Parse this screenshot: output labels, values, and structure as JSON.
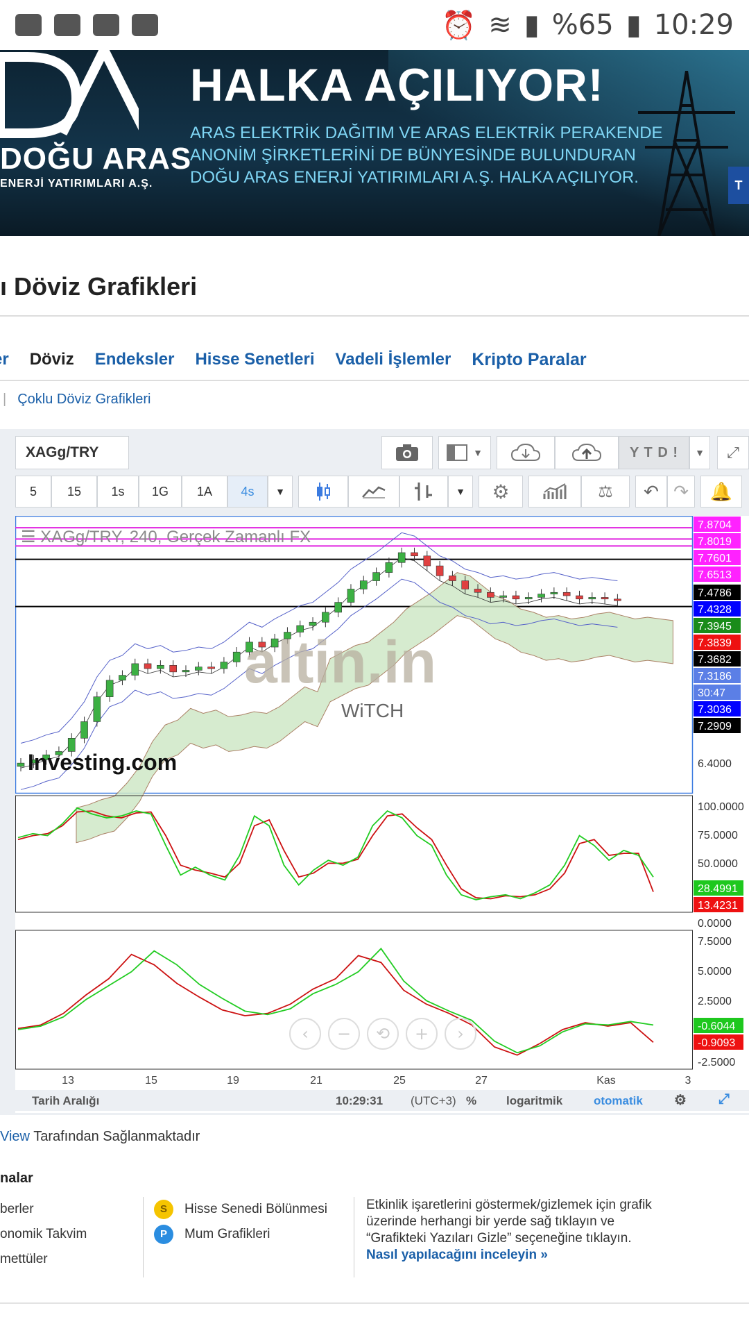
{
  "status_bar": {
    "battery": "%65",
    "time": "10:29"
  },
  "banner": {
    "logo_name": "DOĞU ARAS",
    "logo_sub": "ENERJİ YATIRIMLARI A.Ş.",
    "headline": "HALKA AÇILIYOR!",
    "subtext": "ARAS ELEKTRİK DAĞITIM VE ARAS ELEKTRİK PERAKENDE ANONİM ŞİRKETLERİNİ DE BÜNYESİNDE BULUNDURAN DOĞU ARAS ENERJİ YATIRIMLARI A.Ş. HALKA AÇILIYOR.",
    "side_tab": "T"
  },
  "page_title": "ı Döviz Grafikleri",
  "nav": {
    "items": [
      "er",
      "Döviz",
      "Endeksler",
      "Hisse Senetleri",
      "Vadeli İşlemler",
      "Kripto Paralar"
    ],
    "active": "Döviz"
  },
  "subnav": {
    "link": "Çoklu Döviz Grafikleri"
  },
  "toolbar": {
    "symbol": "XAGg/TRY",
    "ytd": "Y T D !",
    "timeframes": [
      "5",
      "15",
      "1s",
      "1G",
      "1A",
      "4s"
    ],
    "selected_timeframe": "4s"
  },
  "chart_header": "XAGg/TRY, 240, Gerçek Zamanlı FX",
  "watermark": {
    "brand": "altin.in",
    "sub": "WiTCH",
    "investing": "Investing.com"
  },
  "chart_data": {
    "type": "candlestick",
    "price_axis_labels": [
      "7.8704",
      "7.8019",
      "7.7601",
      "7.6513",
      "7.4786",
      "7.4328",
      "7.3945",
      "7.3839",
      "7.3682",
      "7.3186",
      "30:47",
      "7.3036",
      "7.2909",
      "6.4000"
    ],
    "price_label_colors": [
      "#ff22ff",
      "#ff22ff",
      "#ff22ff",
      "#ff22ff",
      "#000000",
      "#0000ff",
      "#1a8c1a",
      "#ee1111",
      "#000000",
      "#5b7fe6",
      "#5b7fe6",
      "#0000ff",
      "#000000",
      "#ffffff"
    ],
    "x_ticks": [
      "13",
      "15",
      "19",
      "21",
      "25",
      "27",
      "Kas",
      "3"
    ],
    "closes": [
      6.45,
      6.47,
      6.5,
      6.52,
      6.6,
      6.7,
      6.85,
      6.95,
      6.98,
      7.05,
      7.02,
      7.04,
      7.0,
      7.01,
      7.03,
      7.02,
      7.06,
      7.12,
      7.18,
      7.15,
      7.2,
      7.24,
      7.28,
      7.3,
      7.36,
      7.42,
      7.5,
      7.55,
      7.6,
      7.66,
      7.72,
      7.7,
      7.64,
      7.58,
      7.55,
      7.5,
      7.48,
      7.45,
      7.46,
      7.44,
      7.45,
      7.47,
      7.48,
      7.46,
      7.44,
      7.45,
      7.44,
      7.43
    ],
    "stochastic": {
      "labels": [
        "100.0000",
        "75.0000",
        "50.0000",
        "28.4991",
        "13.4231",
        "0.0000"
      ],
      "k_color": "#22cc22",
      "d_color": "#cc1111",
      "k": [
        68,
        72,
        70,
        82,
        98,
        92,
        88,
        90,
        95,
        92,
        60,
        30,
        38,
        30,
        25,
        50,
        90,
        80,
        40,
        20,
        35,
        45,
        40,
        48,
        80,
        95,
        88,
        70,
        60,
        30,
        10,
        5,
        8,
        10,
        6,
        12,
        20,
        40,
        70,
        60,
        45,
        55,
        50,
        28
      ],
      "d": [
        66,
        70,
        72,
        80,
        94,
        95,
        90,
        88,
        93,
        94,
        70,
        40,
        35,
        32,
        28,
        42,
        80,
        86,
        55,
        28,
        32,
        42,
        42,
        46,
        70,
        90,
        92,
        78,
        66,
        40,
        16,
        7,
        6,
        9,
        8,
        10,
        16,
        32,
        62,
        66,
        50,
        52,
        52,
        13
      ]
    },
    "indicator2": {
      "labels": [
        "7.5000",
        "5.0000",
        "2.5000",
        "-0.6044",
        "-0.9093",
        "-2.5000"
      ],
      "green": [
        0.2,
        0.5,
        1.3,
        2.8,
        4.0,
        5.2,
        7.0,
        5.8,
        4.1,
        2.9,
        1.8,
        1.5,
        2.0,
        3.3,
        4.1,
        5.2,
        7.2,
        4.4,
        2.7,
        1.8,
        1.0,
        -0.8,
        -1.8,
        -1.2,
        0.0,
        0.7,
        0.6,
        0.9,
        0.6
      ],
      "red": [
        0.3,
        0.6,
        1.6,
        3.2,
        4.6,
        6.7,
        5.8,
        4.2,
        3.0,
        1.9,
        1.4,
        1.6,
        2.4,
        3.7,
        4.6,
        6.6,
        6.0,
        3.6,
        2.4,
        1.6,
        0.6,
        -1.3,
        -2.0,
        -1.0,
        0.2,
        0.8,
        0.5,
        0.8,
        -0.9
      ]
    }
  },
  "zoom_controls": [
    "‹",
    "−",
    "⟲",
    "+",
    "›"
  ],
  "bottom_bar": {
    "range": "Tarih Aralığı",
    "time": "10:29:31",
    "tz": "(UTC+3)",
    "percent": "%",
    "log": "logaritmik",
    "auto": "otomatik"
  },
  "provided_by": {
    "link": "View",
    "text": " Tarafından Sağlanmaktadır"
  },
  "legend": {
    "title": "nalar",
    "col1": [
      "berler",
      "onomik Takvim",
      "mettüler"
    ],
    "col2": [
      {
        "badge": "S",
        "label": "Hisse Senedi Bölünmesi",
        "color": "#f5c400"
      },
      {
        "badge": "P",
        "label": "Mum Grafikleri",
        "color": "#2b8de0"
      }
    ],
    "note": "Etkinlik işaretlerini göstermek/gizlemek için grafik üzerinde herhangi bir yerde sağ tıklayın ve “Grafikteki Yazıları Gizle” seçeneğine tıklayın.",
    "note_link": "Nasıl yapılacağını inceleyin »"
  }
}
